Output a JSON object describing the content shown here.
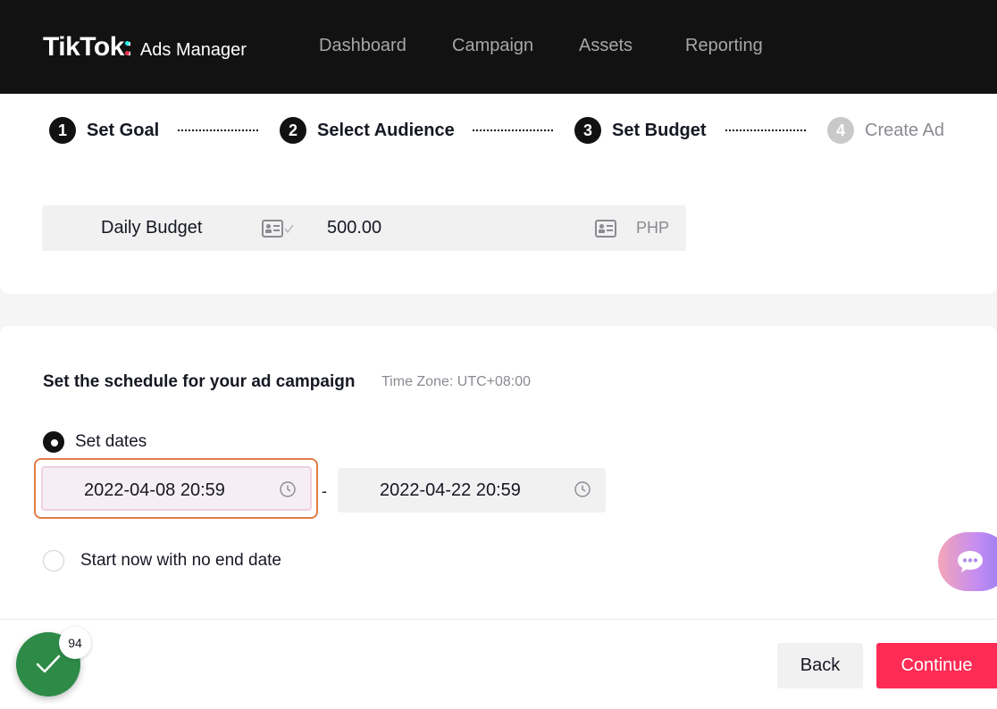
{
  "header": {
    "brand": "TikTok",
    "brand_colon": ":",
    "product": "Ads Manager",
    "nav": [
      {
        "label": "Dashboard"
      },
      {
        "label": "Campaign"
      },
      {
        "label": "Assets"
      },
      {
        "label": "Reporting"
      }
    ]
  },
  "steps": [
    {
      "number": "1",
      "label": "Set Goal",
      "state": "done"
    },
    {
      "number": "2",
      "label": "Select Audience",
      "state": "done"
    },
    {
      "number": "3",
      "label": "Set Budget",
      "state": "current"
    },
    {
      "number": "4",
      "label": "Create Ad",
      "state": "upcoming"
    }
  ],
  "budget": {
    "label": "Daily Budget",
    "value": "500.00",
    "currency": "PHP"
  },
  "schedule": {
    "title": "Set the schedule for your ad campaign",
    "timezone": "Time Zone: UTC+08:00",
    "options": [
      {
        "label": "Set dates",
        "checked": true
      },
      {
        "label": "Start now with no end date",
        "checked": false
      }
    ],
    "start_date": "2022-04-08 20:59",
    "separator": "-",
    "end_date": "2022-04-22 20:59"
  },
  "footer": {
    "check_count": "94",
    "back_label": "Back",
    "continue_label": "Continue"
  },
  "colors": {
    "header_bg": "#121212",
    "accent": "#fe2c55",
    "focus_outline": "#e07e45",
    "success": "#2e8b47"
  }
}
